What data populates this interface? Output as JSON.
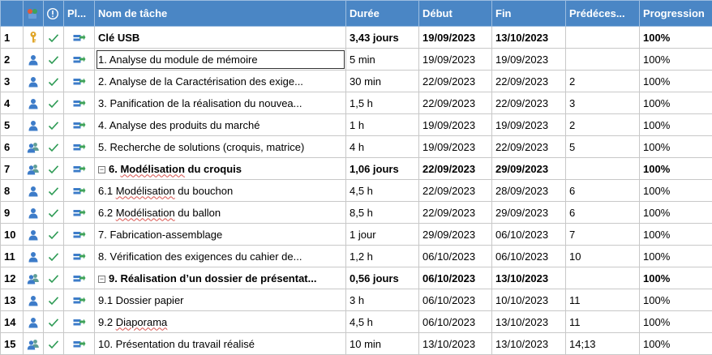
{
  "columns": {
    "num": "",
    "icon": "",
    "indicator": "",
    "planning": "Pl...",
    "name": "Nom de tâche",
    "duration": "Durée",
    "start": "Début",
    "end": "Fin",
    "predecessors": "Prédéces...",
    "progress": "Progression"
  },
  "tasks": [
    {
      "num": "1",
      "name": "Clé USB",
      "duration": "3,43 jours",
      "start": "19/09/2023",
      "end": "13/10/2023",
      "pred": "",
      "progress": "100%"
    },
    {
      "num": "2",
      "name": "1. Analyse du module de mémoire",
      "duration": "5 min",
      "start": "19/09/2023",
      "end": "19/09/2023",
      "pred": "",
      "progress": "100%"
    },
    {
      "num": "3",
      "name": "2. Analyse de la Caractérisation des exige...",
      "duration": "30 min",
      "start": "22/09/2023",
      "end": "22/09/2023",
      "pred": "2",
      "progress": "100%"
    },
    {
      "num": "4",
      "name": "3. Panification de la réalisation du nouvea...",
      "duration": "1,5 h",
      "start": "22/09/2023",
      "end": "22/09/2023",
      "pred": "3",
      "progress": "100%"
    },
    {
      "num": "5",
      "name": "4. Analyse des produits du marché",
      "duration": "1 h",
      "start": "19/09/2023",
      "end": "19/09/2023",
      "pred": "2",
      "progress": "100%"
    },
    {
      "num": "6",
      "name": "5. Recherche de solutions (croquis, matrice)",
      "duration": "4 h",
      "start": "19/09/2023",
      "end": "22/09/2023",
      "pred": "5",
      "progress": "100%"
    },
    {
      "num": "7",
      "name_prefix": "6. ",
      "name_wavy": "Modélisation",
      "name_suffix": " du croquis",
      "duration": "1,06 jours",
      "start": "22/09/2023",
      "end": "29/09/2023",
      "pred": "",
      "progress": "100%"
    },
    {
      "num": "8",
      "name_prefix": "6.1 ",
      "name_wavy": "Modélisation",
      "name_suffix": " du bouchon",
      "duration": "4,5 h",
      "start": "22/09/2023",
      "end": "28/09/2023",
      "pred": "6",
      "progress": "100%"
    },
    {
      "num": "9",
      "name_prefix": "6.2 ",
      "name_wavy": "Modélisation",
      "name_suffix": " du ballon",
      "duration": "8,5 h",
      "start": "22/09/2023",
      "end": "29/09/2023",
      "pred": "6",
      "progress": "100%"
    },
    {
      "num": "10",
      "name": "7. Fabrication-assemblage",
      "duration": "1 jour",
      "start": "29/09/2023",
      "end": "06/10/2023",
      "pred": "7",
      "progress": "100%"
    },
    {
      "num": "11",
      "name": "8. Vérification des exigences du cahier de...",
      "duration": "1,2 h",
      "start": "06/10/2023",
      "end": "06/10/2023",
      "pred": "10",
      "progress": "100%"
    },
    {
      "num": "12",
      "name": "9. Réalisation d’un dossier de présentat...",
      "duration": "0,56 jours",
      "start": "06/10/2023",
      "end": "13/10/2023",
      "pred": "",
      "progress": "100%"
    },
    {
      "num": "13",
      "name": "9.1 Dossier papier",
      "duration": "3 h",
      "start": "06/10/2023",
      "end": "10/10/2023",
      "pred": "11",
      "progress": "100%"
    },
    {
      "num": "14",
      "name_prefix": "9.2 ",
      "name_wavy": "Diaporama",
      "name_suffix": "",
      "duration": "4,5 h",
      "start": "06/10/2023",
      "end": "13/10/2023",
      "pred": "11",
      "progress": "100%"
    },
    {
      "num": "15",
      "name": "10. Présentation du travail réalisé",
      "duration": "10 min",
      "start": "13/10/2023",
      "end": "13/10/2023",
      "pred": "14;13",
      "progress": "100%"
    }
  ],
  "icons": {
    "header_icon": "task-type-header-icon",
    "header_indicator": "info-circle-icon",
    "milestone": "key-icon",
    "single_resource": "person-icon",
    "multi_resource": "group-icon",
    "complete": "checkmark-icon",
    "planning": "auto-schedule-icon"
  },
  "colors": {
    "header_bg": "#4a86c5",
    "check": "#2e9b55",
    "person": "#3d7cc9",
    "group": "#4c8b84",
    "key": "#e0a62a",
    "wavy_underline": "#d9534f"
  },
  "selected_row": "2"
}
